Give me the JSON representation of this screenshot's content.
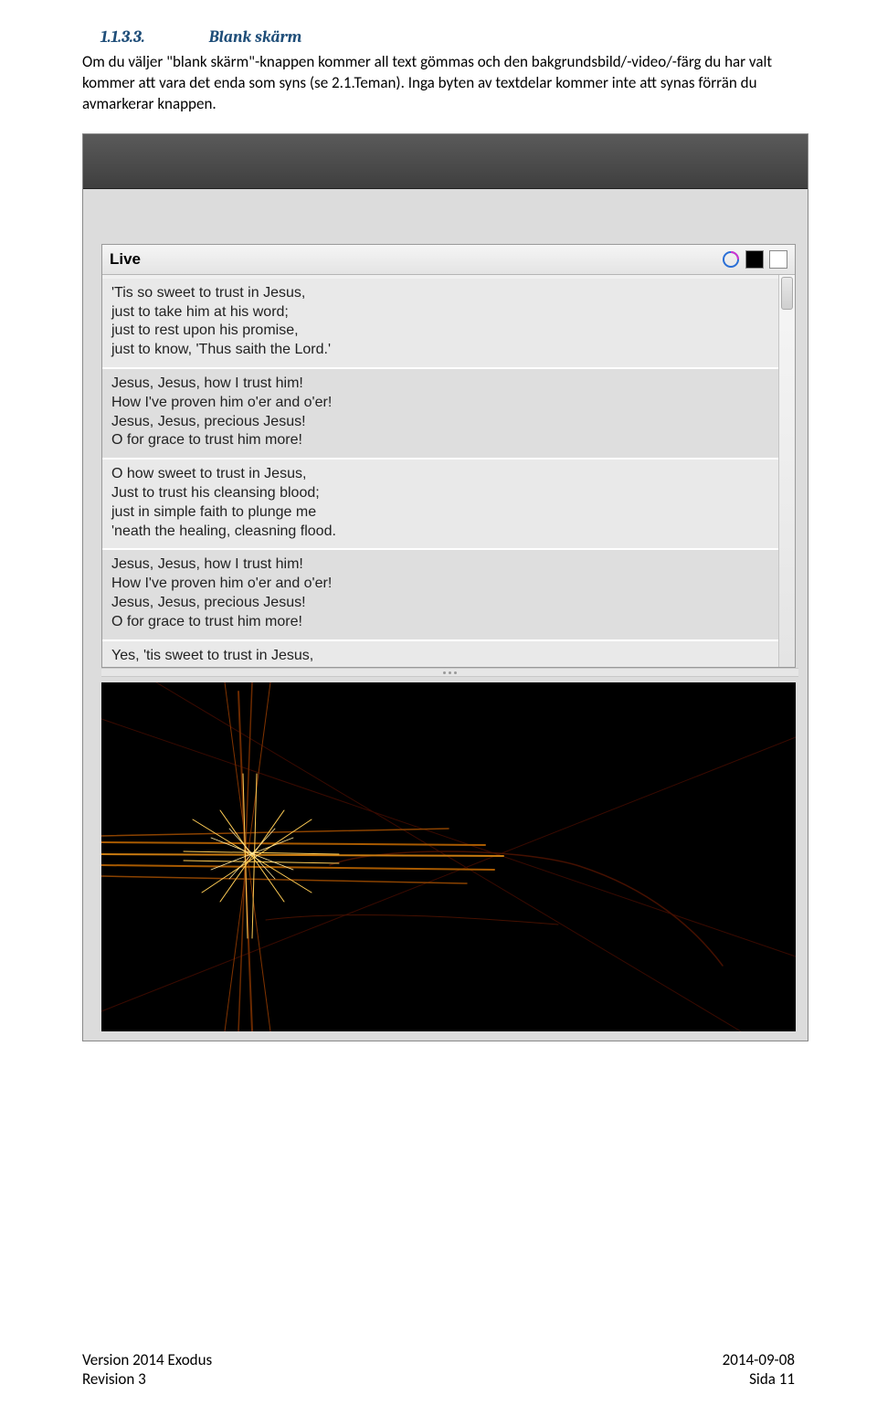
{
  "heading": {
    "number": "1.1.3.3.",
    "title": "Blank skärm"
  },
  "paragraph": "Om du väljer \"blank skärm\"-knappen kommer all text gömmas och den bakgrundsbild/-video/-färg du har valt kommer att vara det enda som syns (se 2.1.Teman). Inga byten av textdelar kommer inte att synas förrän du avmarkerar knappen.",
  "livePanel": {
    "title": "Live",
    "icons": [
      "swirl-icon",
      "blank-black-icon",
      "blank-white-icon"
    ],
    "verses": [
      "'Tis so sweet to trust in Jesus,\njust to take him at his word;\njust to rest upon his promise,\njust to know, 'Thus saith the Lord.'",
      "Jesus, Jesus, how I trust him!\nHow I've proven him o'er and o'er!\nJesus, Jesus, precious Jesus!\nO for grace to trust him more!",
      "O how sweet to trust in Jesus,\nJust to trust his cleansing blood;\njust in simple faith to plunge me\n'neath the healing, cleasning flood.",
      "Jesus, Jesus, how I trust him!\nHow I've proven him o'er and o'er!\nJesus, Jesus, precious Jesus!\nO for grace to trust him more!",
      "Yes, 'tis sweet to trust in Jesus,"
    ]
  },
  "footer": {
    "versionLine": "Version 2014 Exodus",
    "revisionLine": "Revision 3",
    "date": "2014-09-08",
    "page": "Sida 11"
  }
}
